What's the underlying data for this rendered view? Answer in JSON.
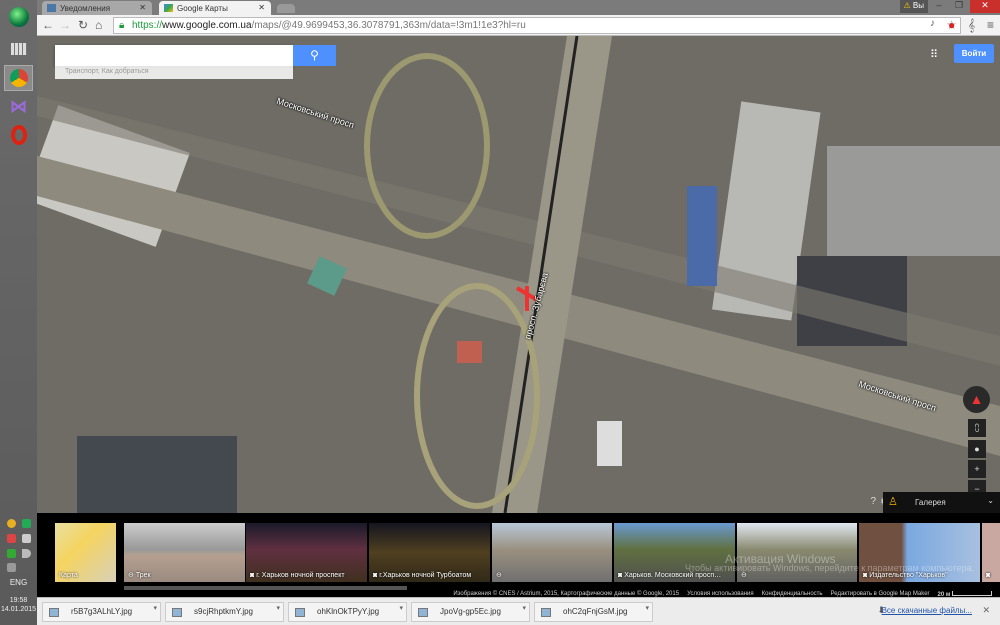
{
  "browser": {
    "tabs": [
      {
        "label": "Уведомления"
      },
      {
        "label": "Google Карты",
        "active": true
      }
    ],
    "url": {
      "scheme": "https://",
      "host": "www.google.com.ua",
      "path": "/maps/@49.9699453,36.3078791,363m/data=!3m1!1e3?hl=ru"
    },
    "warning_label": "Вы"
  },
  "map": {
    "search_placeholder": "",
    "transit_label": "Транспорт, Как добраться",
    "signin_label": "Войти",
    "road_labels": [
      "Московський просп",
      "просп. Зубарєва",
      "Московський просп"
    ],
    "gallery_label": "Галерея",
    "accent": "#4d90fe"
  },
  "strip": {
    "thumbs": [
      {
        "label": "Карта",
        "icon": "map"
      },
      {
        "label": "Трек",
        "icon": "track"
      },
      {
        "label": "г. Харьков ночной проспект",
        "icon": "camera"
      },
      {
        "label": "г.Харьков ночной Турбоатом",
        "icon": "camera"
      },
      {
        "label": "",
        "icon": "track"
      },
      {
        "label": "Харьков. Московский просп…",
        "icon": "camera"
      },
      {
        "label": "",
        "icon": "track"
      },
      {
        "label": "Издательство \"Харьков\"",
        "icon": "camera"
      },
      {
        "label": "",
        "icon": "camera"
      }
    ],
    "footer": {
      "copyright": "Изображения © CNES / Astrium, 2015, Картографические данные © Google, 2015",
      "terms": "Условия использования",
      "privacy": "Конфиденциальность",
      "edit": "Редактировать в Google Map Maker",
      "scale": "20 м"
    }
  },
  "watermark": {
    "title": "Активация Windows",
    "text": "Чтобы активировать Windows, перейдите к параметрам компьютера."
  },
  "downloads": {
    "items": [
      "r5B7g3ALhLY.jpg",
      "s9cjRhptkmY.jpg",
      "ohKlnOkTPyY.jpg",
      "JpoVg-gp5Ec.jpg",
      "ohC2qFnjGsM.jpg"
    ],
    "all_label": "Все скачанные файлы..."
  },
  "system": {
    "lang": "ENG",
    "time": "19:58",
    "date": "14.01.2015"
  }
}
